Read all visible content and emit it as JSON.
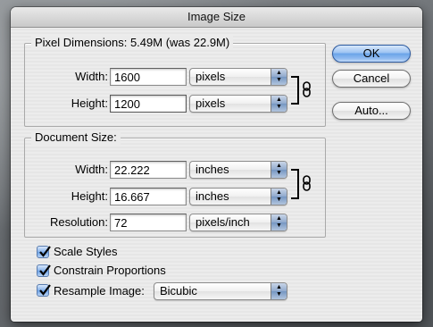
{
  "window": {
    "title": "Image Size"
  },
  "pixel_dimensions": {
    "label": "Pixel Dimensions:",
    "size_info": "5.49M (was 22.9M)",
    "width_label": "Width:",
    "width_value": "1600",
    "width_unit": "pixels",
    "height_label": "Height:",
    "height_value": "1200",
    "height_unit": "pixels"
  },
  "document_size": {
    "label": "Document Size:",
    "width_label": "Width:",
    "width_value": "22.222",
    "width_unit": "inches",
    "height_label": "Height:",
    "height_value": "16.667",
    "height_unit": "inches",
    "resolution_label": "Resolution:",
    "resolution_value": "72",
    "resolution_unit": "pixels/inch"
  },
  "options": {
    "scale_styles": {
      "label": "Scale Styles",
      "checked": true
    },
    "constrain_proportions": {
      "label": "Constrain Proportions",
      "checked": true
    },
    "resample_image": {
      "label": "Resample Image:",
      "checked": true,
      "method": "Bicubic"
    }
  },
  "buttons": {
    "ok": "OK",
    "cancel": "Cancel",
    "auto": "Auto..."
  },
  "icons": {
    "popup_arrows": "up-down-arrows-icon",
    "link": "chain-link-icon",
    "check": "checkmark-icon"
  },
  "colors": {
    "default_button": "#6aa3e8",
    "checkbox": "#85b1ea"
  }
}
